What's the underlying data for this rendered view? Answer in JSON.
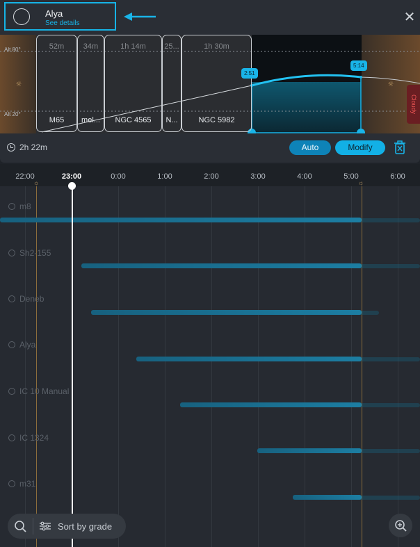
{
  "header": {
    "object_name": "Alya",
    "details_link": "See details",
    "close_icon": "close-icon"
  },
  "altitude_plot": {
    "alt_top_label": "Alt 80°",
    "alt_bottom_label": "Alt 20°",
    "blocks": [
      {
        "duration": "52m",
        "name": "M65"
      },
      {
        "duration": "34m",
        "name": "mel..."
      },
      {
        "duration": "1h 14m",
        "name": "NGC 4565"
      },
      {
        "duration": "25...",
        "name": "N..."
      },
      {
        "duration": "1h 30m",
        "name": "NGC 5982"
      }
    ],
    "start_tag": "2:51",
    "end_tag": "5:14",
    "side_tag": "Cloudy",
    "colors": {
      "accent": "#19b4e8",
      "twilight": "#6b4a2c"
    }
  },
  "controls": {
    "duration": "2h 22m",
    "auto_label": "Auto",
    "modify_label": "Modify",
    "trash_icon": "trash-icon"
  },
  "timeline": {
    "ticks": [
      "22:00",
      "23:00",
      "0:00",
      "1:00",
      "2:00",
      "3:00",
      "4:00",
      "5:00",
      "6:00"
    ],
    "current_time": "23:00",
    "rows": [
      {
        "label": "m8"
      },
      {
        "label": "Sh2-155"
      },
      {
        "label": "Deneb"
      },
      {
        "label": "Alya"
      },
      {
        "label": "IC 10 Manual"
      },
      {
        "label": "IC 1324"
      },
      {
        "label": "m31"
      }
    ]
  },
  "footer": {
    "sort_label": "Sort by grade",
    "search_icon": "search-icon",
    "zoom_icon": "zoom-in-icon"
  }
}
